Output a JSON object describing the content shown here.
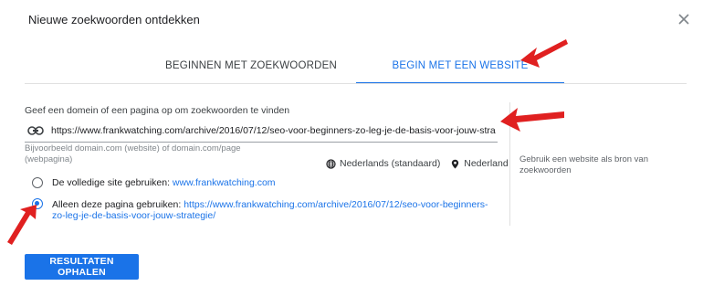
{
  "dialog": {
    "title": "Nieuwe zoekwoorden ontdekken"
  },
  "tabs": [
    {
      "label": "BEGINNEN MET ZOEKWOORDEN",
      "active": false
    },
    {
      "label": "BEGIN MET EEN WEBSITE",
      "active": true
    }
  ],
  "form": {
    "label": "Geef een domein of een pagina op om zoekwoorden te vinden",
    "url_value": "https://www.frankwatching.com/archive/2016/07/12/seo-voor-beginners-zo-leg-je-de-basis-voor-jouw-stra",
    "helper_text": "Bijvoorbeeld domain.com (website) of domain.com/page (webpagina)",
    "language": "Nederlands (standaard)",
    "location": "Nederland",
    "options": [
      {
        "label": "De volledige site gebruiken:",
        "link": "www.frankwatching.com",
        "selected": false
      },
      {
        "label": "Alleen deze pagina gebruiken:",
        "link": "https://www.frankwatching.com/archive/2016/07/12/seo-voor-beginners-zo-leg-je-de-basis-voor-jouw-strategie/",
        "selected": true
      }
    ],
    "side_help": "Gebruik een website als bron van zoekwoorden",
    "submit_label": "RESULTATEN OPHALEN"
  },
  "colors": {
    "accent": "#1a73e8",
    "annotation_arrow": "#e02020"
  },
  "icons": [
    "close-icon",
    "link-icon",
    "globe-icon",
    "location-pin-icon"
  ]
}
